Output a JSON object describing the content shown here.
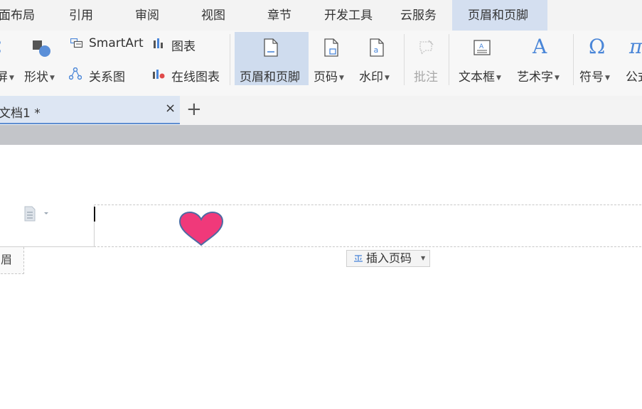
{
  "menu": {
    "tabs": [
      {
        "label": "面布局"
      },
      {
        "label": "引用"
      },
      {
        "label": "审阅"
      },
      {
        "label": "视图"
      },
      {
        "label": "章节"
      },
      {
        "label": "开发工具"
      },
      {
        "label": "云服务"
      },
      {
        "label": "页眉和页脚",
        "active": true
      }
    ]
  },
  "ribbon": {
    "picture_partial": "屏",
    "shapes": "形状",
    "smartart": "SmartArt",
    "chart": "图表",
    "relation": "关系图",
    "online_chart": "在线图表",
    "header_footer": "页眉和页脚",
    "page_number": "页码",
    "watermark": "水印",
    "comment": "批注",
    "textbox": "文本框",
    "wordart": "艺术字",
    "symbol": "符号",
    "formula_partial": "公式"
  },
  "icons": {
    "wordart_glyph": "A",
    "symbol_glyph": "Ω",
    "formula_glyph": "π"
  },
  "doc_tab": {
    "title": "文档1 *",
    "close": "×",
    "new_tab": "+"
  },
  "page": {
    "header_label": "页眉",
    "insert_page_number": "插入页码"
  },
  "colors": {
    "accent": "#5f8ed1",
    "active_tab": "#d4dff0",
    "heart": "#f0397a"
  }
}
